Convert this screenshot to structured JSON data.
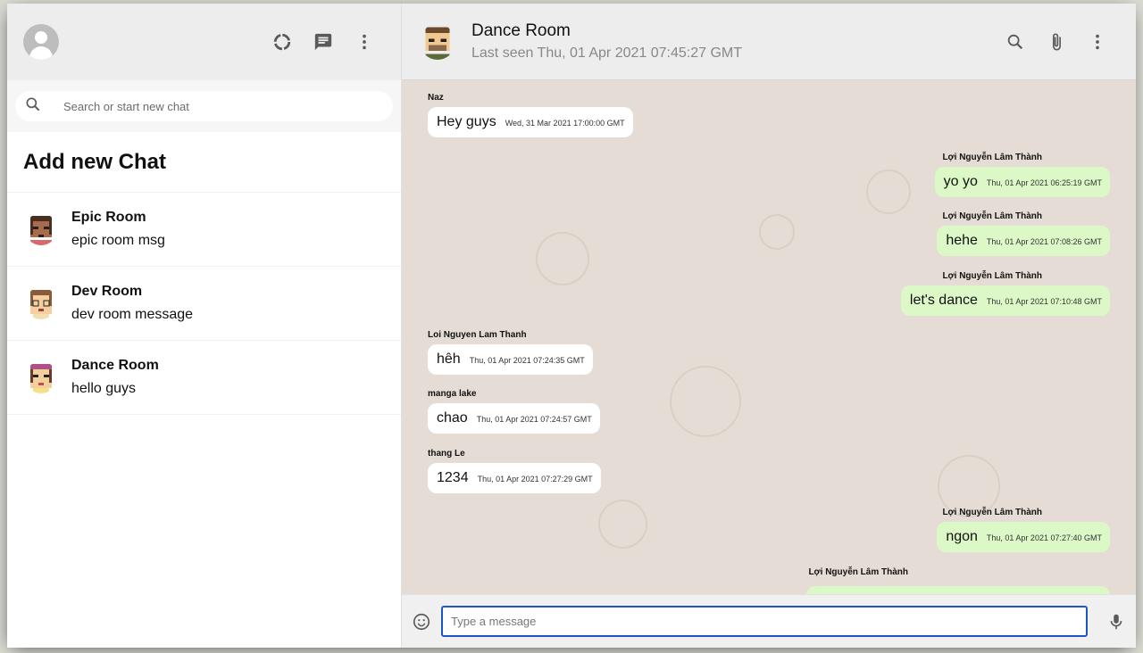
{
  "sidebar": {
    "icons": [
      "user-avatar-icon",
      "status-icon",
      "new-chat-icon",
      "more-vert-icon"
    ],
    "search": {
      "placeholder": "Search or start new chat"
    },
    "add_chat_label": "Add new Chat",
    "chats": [
      {
        "name": "Epic Room",
        "last_message": "epic room msg"
      },
      {
        "name": "Dev Room",
        "last_message": "dev room message"
      },
      {
        "name": "Dance Room",
        "last_message": "hello guys"
      }
    ]
  },
  "chat": {
    "room_name": "Dance Room",
    "last_seen": "Last seen Thu, 01 Apr 2021 07:45:27 GMT",
    "header_icons": [
      "search-icon",
      "attach-icon",
      "more-vert-icon"
    ],
    "messages": [
      {
        "sender": "Naz",
        "text": "Hey guys",
        "time": "Wed, 31 Mar 2021 17:00:00 GMT",
        "mine": false
      },
      {
        "sender": "Lợi Nguyễn Lâm Thành",
        "text": "yo yo",
        "time": "Thu, 01 Apr 2021 06:25:19 GMT",
        "mine": true
      },
      {
        "sender": "Lợi Nguyễn Lâm Thành",
        "text": "hehe",
        "time": "Thu, 01 Apr 2021 07:08:26 GMT",
        "mine": true
      },
      {
        "sender": "Lợi Nguyễn Lâm Thành",
        "text": "let's dance",
        "time": "Thu, 01 Apr 2021 07:10:48 GMT",
        "mine": true
      },
      {
        "sender": "Loi Nguyen Lam Thanh",
        "text": "hêh",
        "time": "Thu, 01 Apr 2021 07:24:35 GMT",
        "mine": false
      },
      {
        "sender": "manga lake",
        "text": "chao",
        "time": "Thu, 01 Apr 2021 07:24:57 GMT",
        "mine": false
      },
      {
        "sender": "thang Le",
        "text": "1234",
        "time": "Thu, 01 Apr 2021 07:27:29 GMT",
        "mine": false
      },
      {
        "sender": "Lợi Nguyễn Lâm Thành",
        "text": "ngon",
        "time": "Thu, 01 Apr 2021 07:27:40 GMT",
        "mine": true
      },
      {
        "sender": "Lợi Nguyễn Lâm Thành",
        "text": "",
        "time": "",
        "mine": true
      }
    ],
    "input": {
      "placeholder": "Type a message",
      "value": ""
    },
    "footer_icons": [
      "emoji-icon",
      "mic-icon"
    ]
  }
}
